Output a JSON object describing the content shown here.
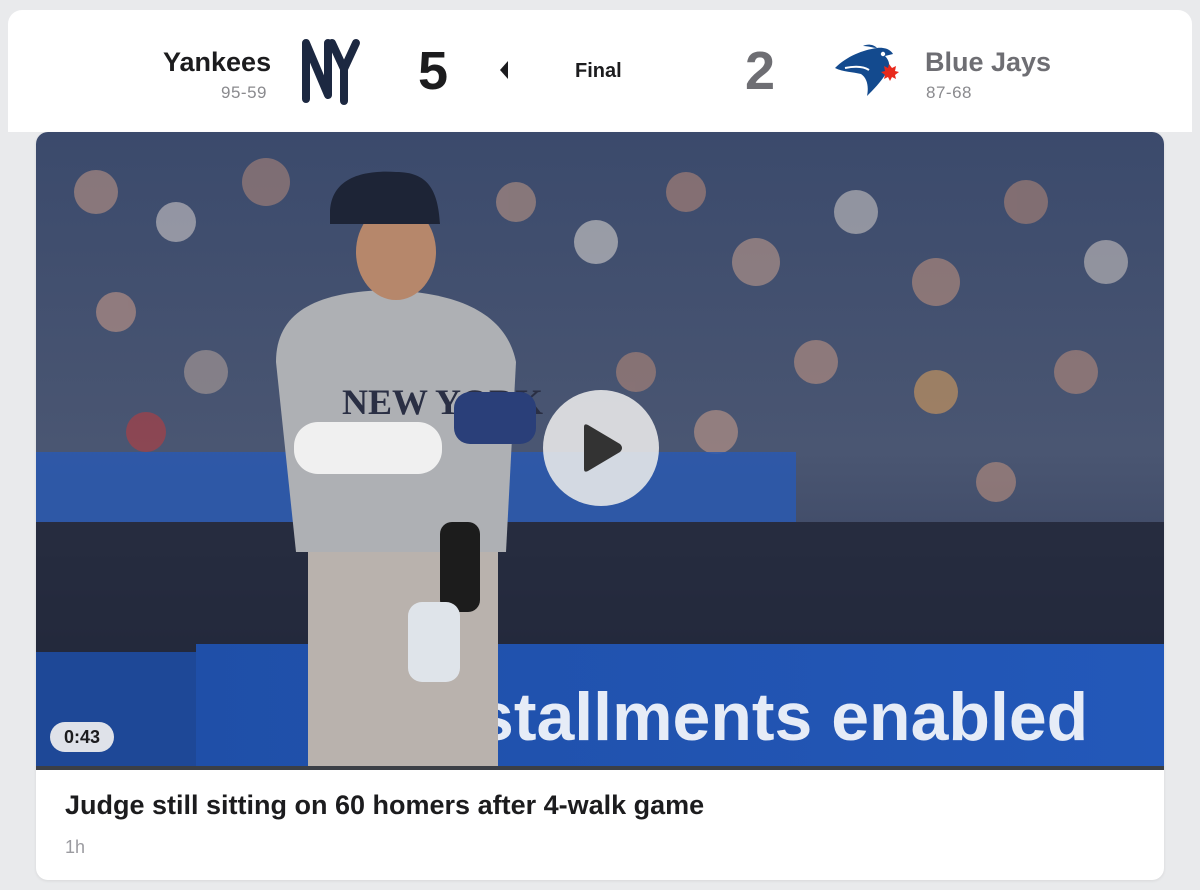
{
  "game": {
    "away": {
      "name": "Yankees",
      "record": "95-59",
      "score": "5",
      "logo": "yankees-logo",
      "color": "#1c2841"
    },
    "home": {
      "name": "Blue Jays",
      "record": "87-68",
      "score": "2",
      "logo": "blue-jays-logo",
      "color": "#6e6e73"
    },
    "status": "Final",
    "winner_indicator": "caret-left-icon"
  },
  "story": {
    "duration": "0:43",
    "headline": "Judge still sitting on 60 homers after 4-walk game",
    "time_ago": "1h",
    "banner_text": "stallments enabled",
    "jersey_text": "NEW YORK",
    "play_icon": "play-icon"
  }
}
